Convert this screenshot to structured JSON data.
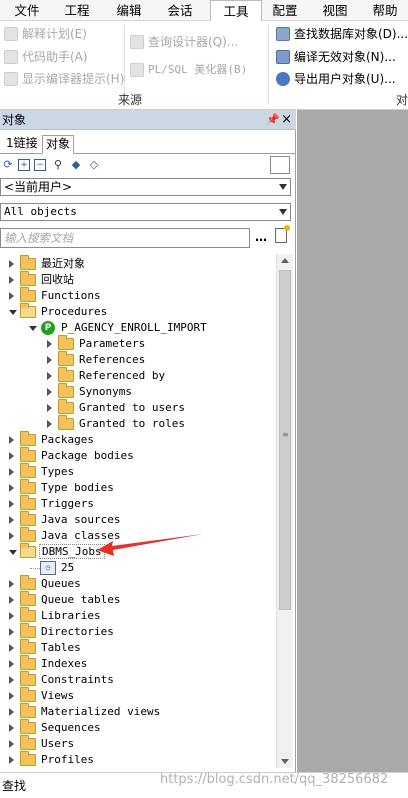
{
  "menubar": {
    "items": [
      {
        "label": "文件"
      },
      {
        "label": "工程"
      },
      {
        "label": "编辑"
      },
      {
        "label": "会话"
      },
      {
        "label": "工具"
      },
      {
        "label": "配置"
      },
      {
        "label": "视图"
      },
      {
        "label": "帮助"
      }
    ],
    "active": "工具"
  },
  "ribbon": {
    "col1": [
      "解释计划(E)",
      "代码助手(A)",
      "显示编译器提示(H)"
    ],
    "col2": [
      "查询设计器(Q)...",
      "PL/SQL 美化器(B)"
    ],
    "col3": [
      "查找数据库对象(D)...",
      "编译无效对象(N)...",
      "导出用户对象(U)..."
    ],
    "group_label": "来源",
    "group_label2": "对"
  },
  "panel": {
    "title": "对象",
    "tabs": [
      "1链接",
      "对象"
    ],
    "user_combo": "<当前用户>",
    "filter_combo": "All objects",
    "search_placeholder": "输入搜索文档"
  },
  "tree": {
    "top_items": [
      "最近对象",
      "回收站",
      "Functions"
    ],
    "procedures_label": "Procedures",
    "procedure_name": "P_AGENCY_ENROLL_IMPORT",
    "procedure_children": [
      "Parameters",
      "References",
      "Referenced by",
      "Synonyms",
      "Granted to users",
      "Granted to roles"
    ],
    "mid_items": [
      "Packages",
      "Package bodies",
      "Types",
      "Type bodies",
      "Triggers",
      "Java sources",
      "Java classes"
    ],
    "jobs_label": "DBMS_Jobs",
    "job_id": "25",
    "bottom_items": [
      "Queues",
      "Queue tables",
      "Libraries",
      "Directories",
      "Tables",
      "Indexes",
      "Constraints",
      "Views",
      "Materialized views",
      "Sequences",
      "Users",
      "Profiles"
    ]
  },
  "bottom": {
    "find_label": "查找",
    "watermark": "https://blog.csdn.net/qq_38256682"
  },
  "colors": {
    "panel_title_bg": "#ccd7e6",
    "annotation_arrow": "#e8302a",
    "procedure_icon": "#1fa21f"
  }
}
